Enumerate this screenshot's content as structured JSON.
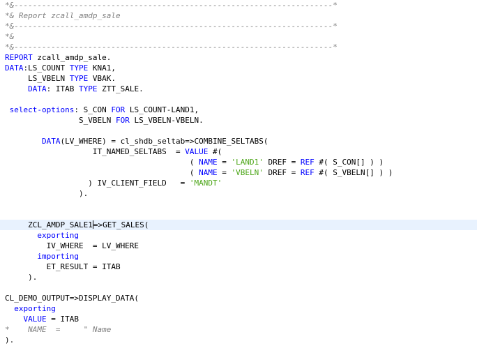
{
  "editor": {
    "language": "ABAP",
    "colors": {
      "keyword": "#0000ff",
      "string": "#4da619",
      "comment": "#808080",
      "default": "#000000",
      "current_line": "#e8f2fe"
    },
    "current_line_index": 21,
    "lines": [
      [
        {
          "t": "*&---------------------------------------------------------------------*",
          "k": "cmt"
        }
      ],
      [
        {
          "t": "*& Report zcall_amdp_sale",
          "k": "cmt"
        }
      ],
      [
        {
          "t": "*&---------------------------------------------------------------------*",
          "k": "cmt"
        }
      ],
      [
        {
          "t": "*&",
          "k": "cmt"
        }
      ],
      [
        {
          "t": "*&---------------------------------------------------------------------*",
          "k": "cmt"
        }
      ],
      [
        {
          "t": "REPORT",
          "k": "kw"
        },
        {
          "t": " zcall_amdp_sale.",
          "k": "ident"
        }
      ],
      [
        {
          "t": "DATA",
          "k": "kw"
        },
        {
          "t": ":LS_COUNT ",
          "k": "ident"
        },
        {
          "t": "TYPE",
          "k": "kw"
        },
        {
          "t": " KNA1,",
          "k": "ident"
        }
      ],
      [
        {
          "t": "     LS_VBELN ",
          "k": "ident"
        },
        {
          "t": "TYPE",
          "k": "kw"
        },
        {
          "t": " VBAK.",
          "k": "ident"
        }
      ],
      [
        {
          "t": "     ",
          "k": "ident"
        },
        {
          "t": "DATA",
          "k": "kw"
        },
        {
          "t": ": ITAB ",
          "k": "ident"
        },
        {
          "t": "TYPE",
          "k": "kw"
        },
        {
          "t": " ZTT_SALE.",
          "k": "ident"
        }
      ],
      [],
      [
        {
          "t": " ",
          "k": "ident"
        },
        {
          "t": "select-options",
          "k": "kw"
        },
        {
          "t": ": S_CON ",
          "k": "ident"
        },
        {
          "t": "FOR",
          "k": "kw"
        },
        {
          "t": " LS_COUNT-LAND1,",
          "k": "ident"
        }
      ],
      [
        {
          "t": "                S_VBELN ",
          "k": "ident"
        },
        {
          "t": "FOR",
          "k": "kw"
        },
        {
          "t": " LS_VBELN-VBELN.",
          "k": "ident"
        }
      ],
      [],
      [
        {
          "t": "        ",
          "k": "ident"
        },
        {
          "t": "DATA",
          "k": "kw"
        },
        {
          "t": "(LV_WHERE) = cl_shdb_seltab=>COMBINE_SELTABS(",
          "k": "ident"
        }
      ],
      [
        {
          "t": "                   IT_NAMED_SELTABS  = ",
          "k": "ident"
        },
        {
          "t": "VALUE",
          "k": "kw"
        },
        {
          "t": " #(",
          "k": "ident"
        }
      ],
      [
        {
          "t": "                                        ( ",
          "k": "ident"
        },
        {
          "t": "NAME",
          "k": "kw"
        },
        {
          "t": " = ",
          "k": "ident"
        },
        {
          "t": "'LAND1'",
          "k": "str"
        },
        {
          "t": " DREF = ",
          "k": "ident"
        },
        {
          "t": "REF",
          "k": "kw"
        },
        {
          "t": " #( S_CON[] ) )",
          "k": "ident"
        }
      ],
      [
        {
          "t": "                                        ( ",
          "k": "ident"
        },
        {
          "t": "NAME",
          "k": "kw"
        },
        {
          "t": " = ",
          "k": "ident"
        },
        {
          "t": "'VBELN'",
          "k": "str"
        },
        {
          "t": " DREF = ",
          "k": "ident"
        },
        {
          "t": "REF",
          "k": "kw"
        },
        {
          "t": " #( S_VBELN[] ) )",
          "k": "ident"
        }
      ],
      [
        {
          "t": "                  ) IV_CLIENT_FIELD   = ",
          "k": "ident"
        },
        {
          "t": "'MANDT'",
          "k": "str"
        }
      ],
      [
        {
          "t": "                ).",
          "k": "ident"
        }
      ],
      [],
      [],
      [
        {
          "t": "     ZCL_AMDP_SALE1",
          "k": "ident"
        },
        {
          "t": "",
          "k": "caret"
        },
        {
          "t": "=>GET_SALES(",
          "k": "ident"
        }
      ],
      [
        {
          "t": "       ",
          "k": "ident"
        },
        {
          "t": "exporting",
          "k": "kw"
        }
      ],
      [
        {
          "t": "         IV_WHERE  = LV_WHERE",
          "k": "ident"
        }
      ],
      [
        {
          "t": "       ",
          "k": "ident"
        },
        {
          "t": "importing",
          "k": "kw"
        }
      ],
      [
        {
          "t": "         ET_RESULT = ITAB",
          "k": "ident"
        }
      ],
      [
        {
          "t": "     ).",
          "k": "ident"
        }
      ],
      [],
      [
        {
          "t": "CL_DEMO_OUTPUT=>DISPLAY_DATA(",
          "k": "ident"
        }
      ],
      [
        {
          "t": "  ",
          "k": "ident"
        },
        {
          "t": "exporting",
          "k": "kw"
        }
      ],
      [
        {
          "t": "    ",
          "k": "ident"
        },
        {
          "t": "VALUE",
          "k": "kw"
        },
        {
          "t": " = ITAB",
          "k": "ident"
        }
      ],
      [
        {
          "t": "*    NAME  =     \" Name",
          "k": "cmt"
        }
      ],
      [
        {
          "t": ").",
          "k": "ident"
        }
      ]
    ]
  }
}
